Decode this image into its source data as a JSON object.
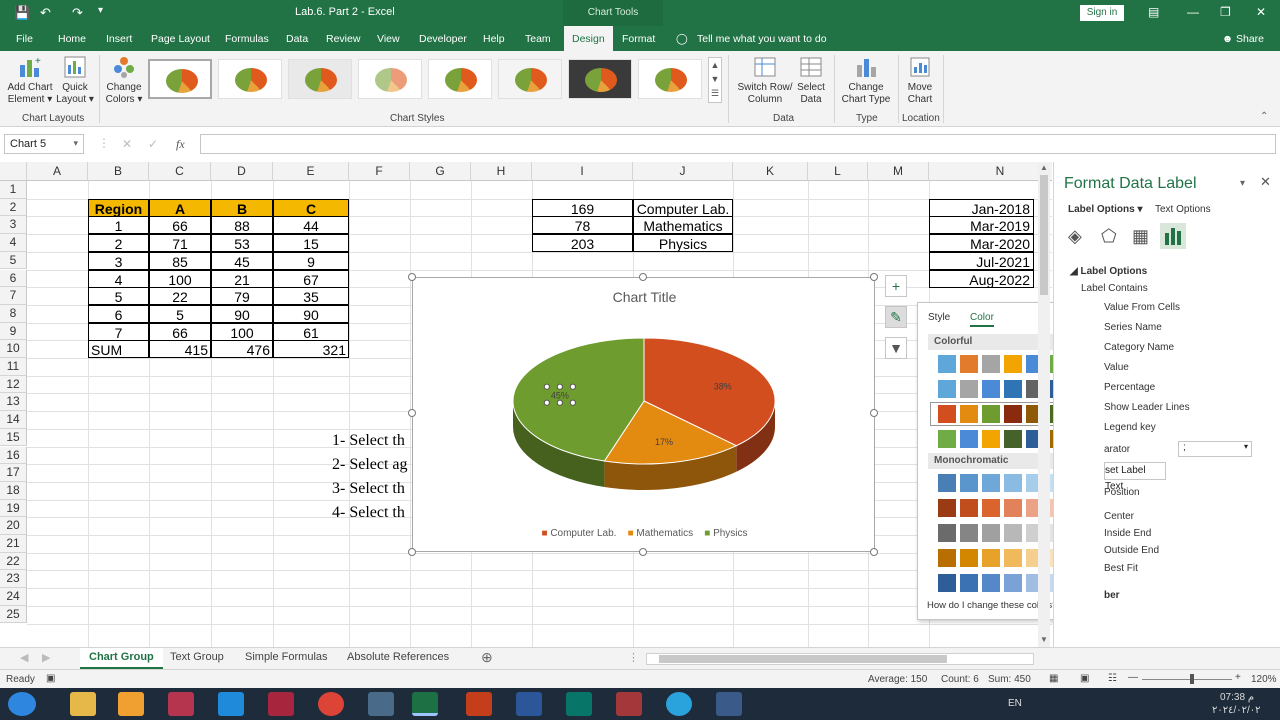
{
  "title_bar": {
    "document": "Lab.6. Part 2  -  Excel",
    "chart_tools": "Chart Tools",
    "sign_in": "Sign in"
  },
  "tabs": [
    "File",
    "Home",
    "Insert",
    "Page Layout",
    "Formulas",
    "Data",
    "Review",
    "View",
    "Developer",
    "Help",
    "Team",
    "Design",
    "Format"
  ],
  "tell_me": "Tell me what you want to do",
  "share": "Share",
  "ribbon": {
    "add_chart_element": "Add Chart Element",
    "quick_layout": "Quick Layout",
    "change_colors": "Change Colors",
    "chart_layouts": "Chart Layouts",
    "chart_styles": "Chart Styles",
    "switch_row_column": "Switch Row/ Column",
    "select_data": "Select Data",
    "data": "Data",
    "change_chart_type": "Change Chart Type",
    "type": "Type",
    "move_chart": "Move Chart",
    "location": "Location"
  },
  "formula_bar": {
    "name_box": "Chart 5",
    "fx": "fx"
  },
  "columns": [
    "A",
    "B",
    "C",
    "D",
    "E",
    "F",
    "G",
    "H",
    "I",
    "J",
    "K",
    "L",
    "M",
    "N"
  ],
  "rows": [
    "1",
    "2",
    "3",
    "4",
    "5",
    "6",
    "7",
    "8",
    "9",
    "10",
    "11",
    "12",
    "13",
    "14",
    "15",
    "16",
    "17",
    "18",
    "19",
    "20",
    "21",
    "22",
    "23",
    "24",
    "25"
  ],
  "region_table": {
    "headers": [
      "Region",
      "A",
      "B",
      "C"
    ],
    "rows": [
      [
        "1",
        "66",
        "88",
        "44"
      ],
      [
        "2",
        "71",
        "53",
        "15"
      ],
      [
        "3",
        "85",
        "45",
        "9"
      ],
      [
        "4",
        "100",
        "21",
        "67"
      ],
      [
        "5",
        "22",
        "79",
        "35"
      ],
      [
        "6",
        "5",
        "90",
        "90"
      ],
      [
        "7",
        "66",
        "100",
        "61"
      ]
    ],
    "sum_row": [
      "SUM",
      "415",
      "476",
      "321"
    ]
  },
  "subject_table": [
    [
      "169",
      "Computer Lab."
    ],
    [
      "78",
      "Mathematics"
    ],
    [
      "203",
      "Physics"
    ]
  ],
  "dates": [
    "Jan-2018",
    "Mar-2019",
    "Mar-2020",
    "Jul-2021",
    "Aug-2022"
  ],
  "instructions": [
    "1- Select th",
    "2- Select ag",
    "3- Select th",
    "4- Select th"
  ],
  "chart": {
    "title": "Chart Title",
    "slice_labels": [
      "38%",
      "17%",
      "45%"
    ],
    "legend": [
      "Computer Lab.",
      "Mathematics",
      "Physics"
    ],
    "colors": [
      "#d24e1e",
      "#e38a10",
      "#6f9c2e"
    ]
  },
  "chart_data": {
    "type": "pie",
    "title": "Chart Title",
    "categories": [
      "Computer Lab.",
      "Mathematics",
      "Physics"
    ],
    "values": [
      169,
      78,
      203
    ],
    "percent_labels": [
      "38%",
      "17%",
      "45%"
    ],
    "legend": "bottom"
  },
  "color_popup": {
    "tab_style": "Style",
    "tab_color": "Color",
    "colorful": "Colorful",
    "monochromatic": "Monochromatic",
    "help": "How do I change these colors?",
    "colorful_rows": [
      [
        "#5fa6d9",
        "#e37b2d",
        "#a5a5a5",
        "#f2a500",
        "#4a8ad6",
        "#6fac46"
      ],
      [
        "#5fa6d9",
        "#a5a5a5",
        "#4a8ad6",
        "#2f75b5",
        "#636363",
        "#2d5e98"
      ],
      [
        "#d24e1e",
        "#e38a10",
        "#6f9c2e",
        "#8a2b10",
        "#8f5a08",
        "#4a6b1f"
      ],
      [
        "#6fac46",
        "#4a8ad6",
        "#f2a500",
        "#44622a",
        "#2d5e98",
        "#9c6a00"
      ]
    ],
    "mono_rows": [
      [
        "#4a7fb5",
        "#5a95cc",
        "#6fa7d8",
        "#8abbe2",
        "#a6cde9",
        "#c3dff1"
      ],
      [
        "#9b3b14",
        "#c04d1c",
        "#d9642e",
        "#e2825a",
        "#eba285",
        "#f3c4b0"
      ],
      [
        "#6b6b6b",
        "#858585",
        "#a0a0a0",
        "#b8b8b8",
        "#cfcfcf",
        "#e3e3e3"
      ],
      [
        "#b86e00",
        "#d38700",
        "#e8a129",
        "#efb95c",
        "#f4cf8e",
        "#f8e1bd"
      ],
      [
        "#2d5e98",
        "#3b72b3",
        "#5588c8",
        "#7ba2d6",
        "#a1bde2",
        "#c6d8ee"
      ]
    ]
  },
  "format_pane": {
    "title": "Format Data Label",
    "label_options_tab": "Label Options",
    "text_options_tab": "Text Options",
    "label_options_section": "Label Options",
    "label_contains": "Label Contains",
    "items": [
      "Value From Cells",
      "Series Name",
      "Category Name",
      "Value",
      "Percentage",
      "Show Leader Lines",
      "Legend key"
    ],
    "separator_label": "arator",
    "separator_value": ";",
    "reset_label": "set Label Text",
    "position": "Position",
    "positions": [
      "Center",
      "Inside End",
      "Outside End",
      "Best Fit"
    ],
    "number": "ber"
  },
  "sheets": [
    "Chart Group",
    "Text Group",
    "Simple Formulas",
    "Absolute References"
  ],
  "status": {
    "ready": "Ready",
    "average": "Average: 150",
    "count": "Count: 6",
    "sum": "Sum: 450",
    "zoom": "120%"
  },
  "taskbar": {
    "lang": "EN",
    "time": "07:38 م",
    "date": "٢٠٢٤/٠٢/٠٢"
  }
}
